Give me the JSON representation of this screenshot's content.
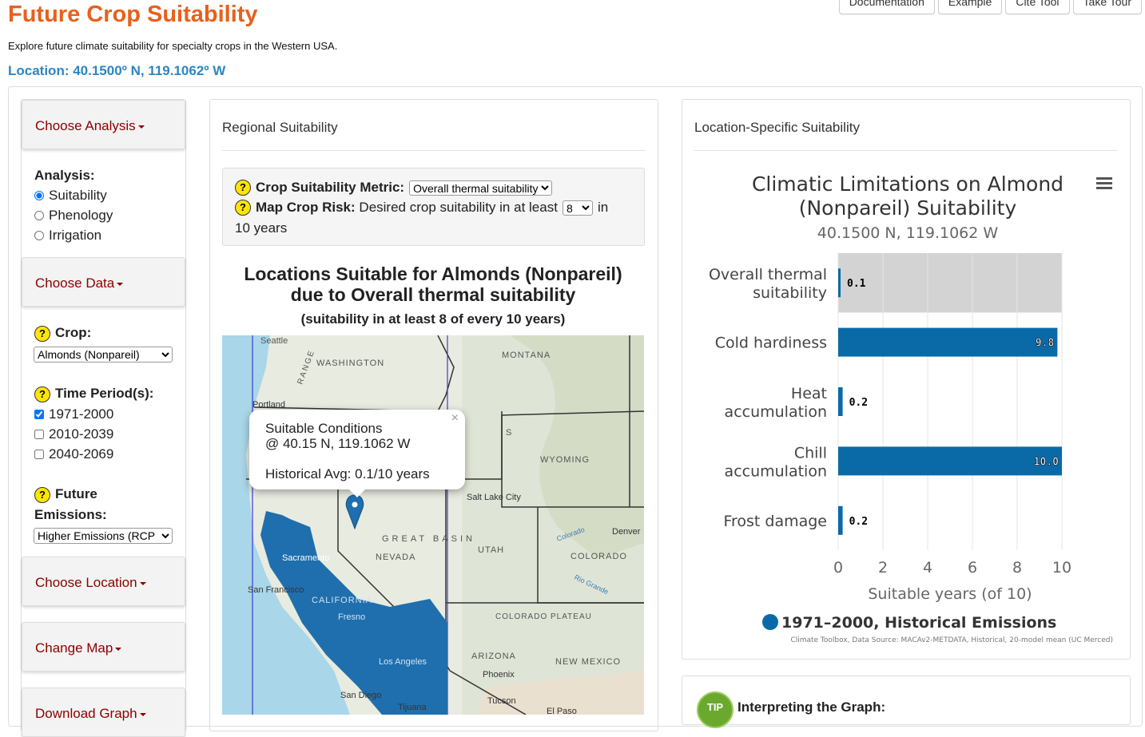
{
  "header": {
    "title": "Future Crop Suitability",
    "subtitle": "Explore future climate suitability for specialty crops in the Western USA.",
    "location": "Location: 40.1500º N, 119.1062º W"
  },
  "topnav": [
    "Documentation",
    "Example",
    "Cite Tool",
    "Take Tour"
  ],
  "sidebar": {
    "choose_analysis": "Choose Analysis",
    "analysis_label": "Analysis:",
    "analysis_options": [
      "Suitability",
      "Phenology",
      "Irrigation"
    ],
    "analysis_selected": "Suitability",
    "choose_data": "Choose Data",
    "crop_label": "Crop:",
    "crop_value": "Almonds (Nonpareil)",
    "time_label": "Time Period(s):",
    "time_options": [
      "1971-2000",
      "2010-2039",
      "2040-2069"
    ],
    "time_checked": [
      "1971-2000"
    ],
    "emissions_label_1": "Future",
    "emissions_label_2": "Emissions:",
    "emissions_value": "Higher Emissions (RCP",
    "choose_location": "Choose Location",
    "change_map": "Change Map",
    "download_graph": "Download Graph",
    "help_glyph": "?"
  },
  "regional": {
    "heading": "Regional Suitability",
    "metric_label": "Crop Suitability Metric:",
    "metric_value": "Overall thermal suitability",
    "risk_label": "Map Crop Risk:",
    "risk_text": "Desired crop suitability in at least",
    "risk_value": "8",
    "risk_in": "in",
    "risk_years": "10 years",
    "map_title_1": "Locations Suitable for Almonds (Nonpareil)",
    "map_title_2": "due to Overall thermal suitability",
    "map_subtitle": "(suitability in at least 8 of every 10 years)",
    "popup": {
      "line1": "Suitable Conditions",
      "line2": "@ 40.15 N, 119.1062 W",
      "line3": "Historical Avg: 0.1/10 years",
      "close": "×"
    },
    "map_labels": [
      "Seattle",
      "WASHINGTON",
      "MONTANA",
      "Portland",
      "WYOMING",
      "Salt Lake City",
      "Denver",
      "GREAT BASIN",
      "NEVADA",
      "UTAH",
      "COLORADO",
      "Sacramento",
      "San Francisco",
      "CALIFORNIA",
      "Fresno",
      "COLORADO PLATEAU",
      "Los Angeles",
      "ARIZONA",
      "NEW MEXICO",
      "Phoenix",
      "San Diego",
      "Tijuana",
      "Tucson",
      "El Paso",
      "Colorado",
      "Rio Grande",
      "RANGE",
      "S"
    ],
    "suitable_color": "#1f6fae"
  },
  "location_panel": {
    "heading": "Location-Specific Suitability",
    "menu_icon": "hamburger-menu-icon",
    "tip_badge": "TIP",
    "tip_title": "Interpreting the Graph:"
  },
  "chart_data": {
    "type": "bar",
    "orientation": "horizontal",
    "title": "Climatic Limitations on Almond (Nonpareil) Suitability",
    "title_1": "Climatic Limitations on Almond",
    "title_2": "(Nonpareil) Suitability",
    "subtitle": "40.1500 N, 119.1062 W",
    "categories": [
      "Overall thermal suitability",
      "Cold hardiness",
      "Heat accumulation",
      "Chill accumulation",
      "Frost damage"
    ],
    "series": [
      {
        "name": "1971-2000, Historical Emissions",
        "values": [
          0.1,
          9.8,
          0.2,
          10.0,
          0.2
        ],
        "color": "#0a6aa8"
      }
    ],
    "data_labels": [
      "0.1",
      "9.8",
      "0.2",
      "10.0",
      "0.2"
    ],
    "xlabel": "Suitable years (of 10)",
    "xlim": [
      0,
      10
    ],
    "ticks": [
      "0",
      "2",
      "4",
      "6",
      "8",
      "10"
    ],
    "highlight_category": "Overall thermal suitability",
    "highlight_color": "#d3d3d3",
    "legend_position": "bottom",
    "credits": "Climate Toolbox, Data Source: MACAv2-METDATA, Historical, 20-model mean (UC Merced)"
  }
}
